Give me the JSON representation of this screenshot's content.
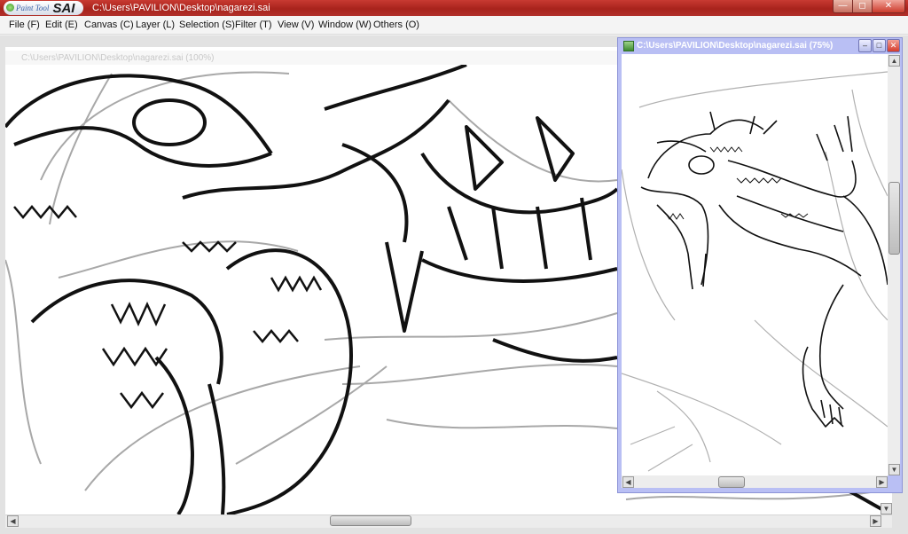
{
  "app": {
    "logo_small": "Paint Tool",
    "logo_big": "SAI",
    "window_title": "C:\\Users\\PAVILION\\Desktop\\nagarezi.sai"
  },
  "window_controls": {
    "minimize": "—",
    "maximize": "◻",
    "close": "✕"
  },
  "menu": [
    {
      "label": "File (F)"
    },
    {
      "label": "Edit (E)"
    },
    {
      "label": "Canvas (C)"
    },
    {
      "label": "Layer (L)"
    },
    {
      "label": "Selection (S)"
    },
    {
      "label": "Filter (T)"
    },
    {
      "label": "View (V)"
    },
    {
      "label": "Window (W)"
    },
    {
      "label": "Others (O)"
    }
  ],
  "main_view": {
    "title": "C:\\Users\\PAVILION\\Desktop\\nagarezi.sai (100%)",
    "hscroll_position": 0.42
  },
  "navigator": {
    "title": "C:\\Users\\PAVILION\\Desktop\\nagarezi.sai (75%)",
    "controls": {
      "minimize": "–",
      "maximize": "□",
      "close": "✕"
    },
    "vscroll_position": 0.45,
    "hscroll_position": 0.45
  },
  "colors": {
    "titlebar": "#b22a22",
    "navigator_frame": "#b9bff4",
    "line_art": "#111111",
    "sketch": "#a8a8a8"
  }
}
